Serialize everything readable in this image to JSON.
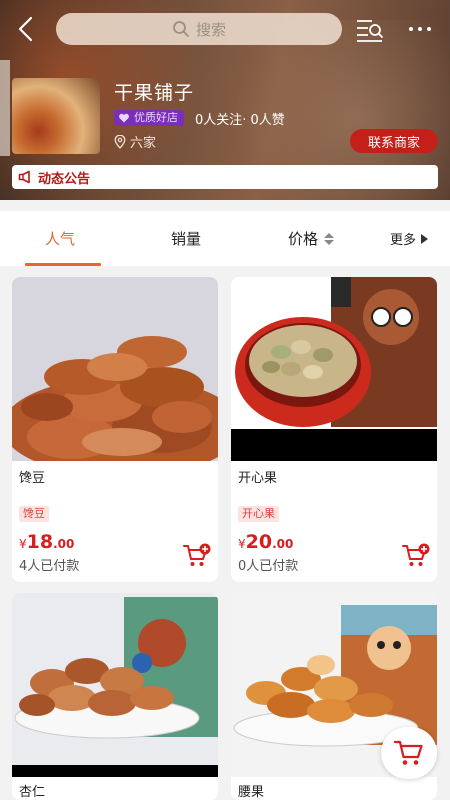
{
  "header": {
    "search_placeholder": "搜索",
    "shop_name": "干果铺子",
    "badge": "优质好店",
    "follow_stats": "0人关注· 0人赞",
    "location": "六家",
    "contact_label": "联系商家",
    "notice_label": "动态公告"
  },
  "tabs": {
    "popular": "人气",
    "sales": "销量",
    "price": "价格",
    "more": "更多"
  },
  "products": [
    {
      "title": "馋豆",
      "tag": "馋豆",
      "price_symbol": "¥",
      "price_int": "18",
      "price_dec": ".00",
      "sold": "4人已付款"
    },
    {
      "title": "开心果",
      "tag": "开心果",
      "price_symbol": "¥",
      "price_int": "20",
      "price_dec": ".00",
      "sold": "0人已付款"
    },
    {
      "title": "杏仁"
    },
    {
      "title": "腰果"
    }
  ],
  "colors": {
    "accent": "#e5682b",
    "price": "#d71d1d",
    "contact_button": "#c4201a",
    "badge": "#7b2fb8"
  }
}
